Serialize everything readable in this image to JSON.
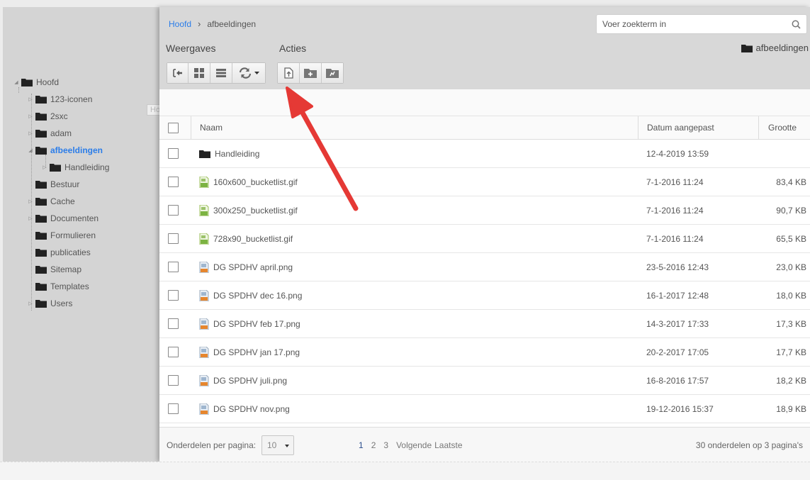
{
  "tree": {
    "root": "Hoofd",
    "items": [
      {
        "label": "123-iconen"
      },
      {
        "label": "2sxc"
      },
      {
        "label": "adam"
      },
      {
        "label": "afbeeldingen"
      },
      {
        "label": "Handleiding"
      },
      {
        "label": "Bestuur"
      },
      {
        "label": "Cache"
      },
      {
        "label": "Documenten"
      },
      {
        "label": "Formulieren"
      },
      {
        "label": "publicaties"
      },
      {
        "label": "Sitemap"
      },
      {
        "label": "Templates"
      },
      {
        "label": "Users"
      }
    ],
    "tooltip": "Hoofd"
  },
  "breadcrumb": {
    "home": "Hoofd",
    "separator": "›",
    "current": "afbeeldingen"
  },
  "search": {
    "placeholder": "Voer zoekterm in"
  },
  "toolbar": {
    "views_label": "Weergaves",
    "actions_label": "Acties",
    "current_folder": "afbeeldingen"
  },
  "grid": {
    "columns": {
      "name": "Naam",
      "date": "Datum aangepast",
      "size": "Grootte"
    },
    "rows": [
      {
        "name": "Handleiding",
        "type": "folder",
        "date": "12-4-2019 13:59",
        "size": ""
      },
      {
        "name": "160x600_bucketlist.gif",
        "type": "gif",
        "date": "7-1-2016 11:24",
        "size": "83,4 KB"
      },
      {
        "name": "300x250_bucketlist.gif",
        "type": "gif",
        "date": "7-1-2016 11:24",
        "size": "90,7 KB"
      },
      {
        "name": "728x90_bucketlist.gif",
        "type": "gif",
        "date": "7-1-2016 11:24",
        "size": "65,5 KB"
      },
      {
        "name": "DG SPDHV april.png",
        "type": "png",
        "date": "23-5-2016 12:43",
        "size": "23,0 KB"
      },
      {
        "name": "DG SPDHV dec 16.png",
        "type": "png",
        "date": "16-1-2017 12:48",
        "size": "18,0 KB"
      },
      {
        "name": "DG SPDHV feb 17.png",
        "type": "png",
        "date": "14-3-2017 17:33",
        "size": "17,3 KB"
      },
      {
        "name": "DG SPDHV jan 17.png",
        "type": "png",
        "date": "20-2-2017 17:05",
        "size": "17,7 KB"
      },
      {
        "name": "DG SPDHV juli.png",
        "type": "png",
        "date": "16-8-2016 17:57",
        "size": "18,2 KB"
      },
      {
        "name": "DG SPDHV nov.png",
        "type": "png",
        "date": "19-12-2016 15:37",
        "size": "18,9 KB"
      }
    ]
  },
  "pager": {
    "per_page_label": "Onderdelen per pagina:",
    "per_page_value": "10",
    "pages": [
      "1",
      "2",
      "3"
    ],
    "next": "Volgende",
    "last": "Laatste",
    "info": "30 onderdelen op 3 pagina's"
  },
  "colors": {
    "accent": "#2b7de9",
    "annotation_arrow": "#e53935"
  }
}
